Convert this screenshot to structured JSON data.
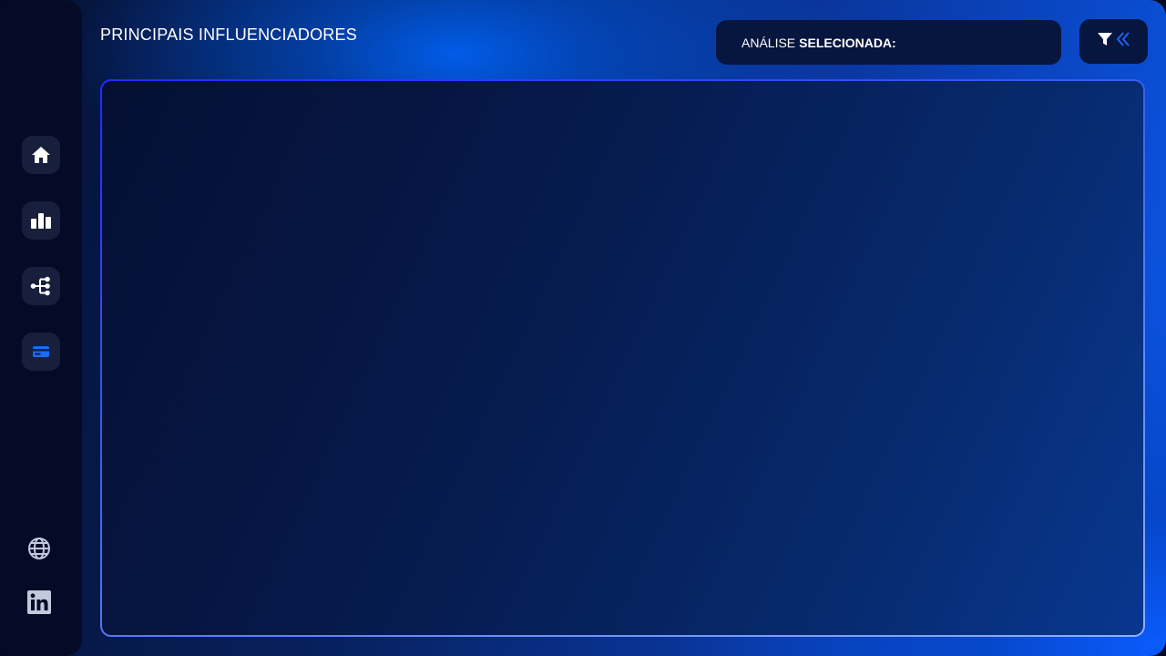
{
  "page": {
    "title": "PRINCIPAIS INFLUENCIADORES"
  },
  "analysis": {
    "label": "ANÁLISE",
    "label_strong": "SELECIONADA:"
  },
  "sidebar": {
    "items": [
      {
        "icon": "home-icon"
      },
      {
        "icon": "bar-chart-icon"
      },
      {
        "icon": "decomposition-tree-icon"
      },
      {
        "icon": "card-icon",
        "active": true
      }
    ],
    "social": [
      {
        "icon": "globe-icon"
      },
      {
        "icon": "linkedin-icon"
      }
    ]
  },
  "toolbar": {
    "filter_icon": "filter-icon",
    "collapse_icon": "double-chevron-left-icon"
  },
  "colors": {
    "accent": "#1a6bff",
    "sidebar_bg": "#050b26",
    "button_bg": "#181f3c",
    "panel_border": "#2a3cff"
  }
}
